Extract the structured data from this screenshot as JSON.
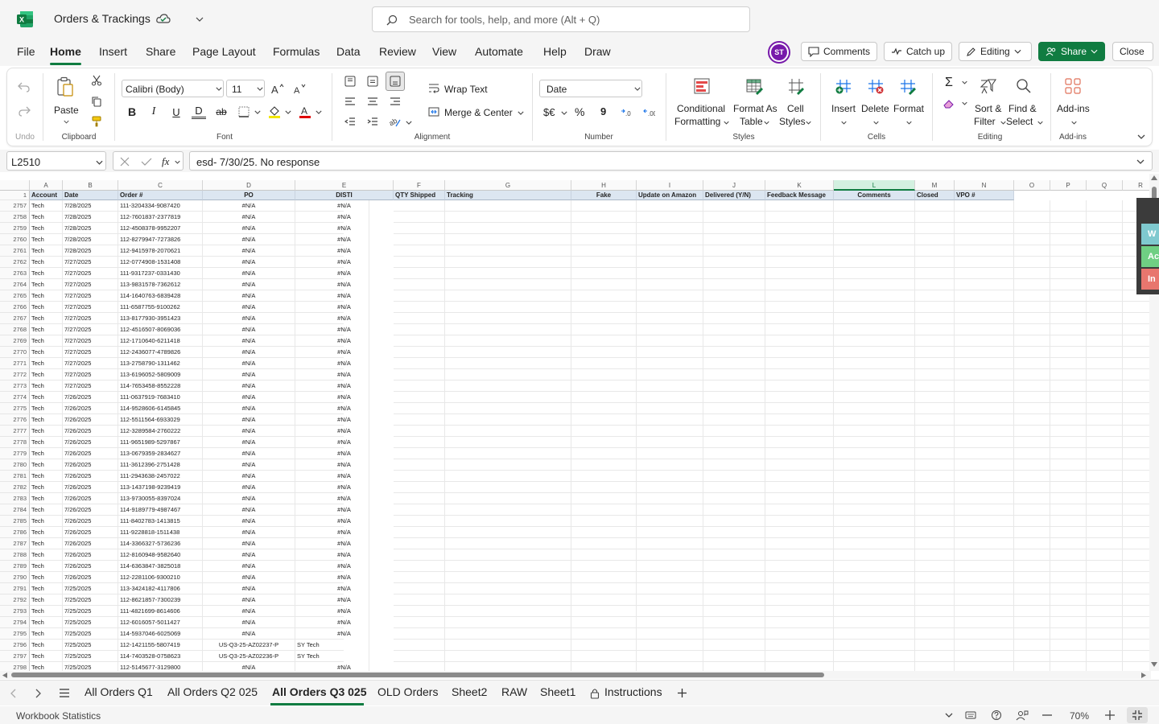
{
  "app": {
    "name": "Excel",
    "file_title": "Orders & Trackings"
  },
  "search": {
    "placeholder": "Search for tools, help, and more (Alt + Q)"
  },
  "menu": [
    "File",
    "Home",
    "Insert",
    "Share",
    "Page Layout",
    "Formulas",
    "Data",
    "Review",
    "View",
    "Automate",
    "Help",
    "Draw"
  ],
  "active_menu": "Home",
  "user": {
    "initials": "ST"
  },
  "top_buttons": {
    "comments": "Comments",
    "catchup": "Catch up",
    "editing": "Editing",
    "share": "Share",
    "close": "Close"
  },
  "ribbon": {
    "undo_group": "Undo",
    "clipboard": {
      "paste": "Paste",
      "group": "Clipboard"
    },
    "font": {
      "name": "Calibri (Body)",
      "size": "11",
      "group": "Font"
    },
    "alignment": {
      "wrap": "Wrap Text",
      "merge": "Merge & Center",
      "group": "Alignment"
    },
    "number": {
      "format": "Date",
      "currency": "$€",
      "percent": "%",
      "comma": "9",
      "group": "Number"
    },
    "styles": {
      "cond_1": "Conditional",
      "cond_2": "Formatting",
      "fmt_1": "Format As",
      "fmt_2": "Table",
      "cell_1": "Cell",
      "cell_2": "Styles",
      "group": "Styles"
    },
    "cells": {
      "insert": "Insert",
      "delete": "Delete",
      "format": "Format",
      "group": "Cells"
    },
    "editing": {
      "sort_1": "Sort &",
      "sort_2": "Filter",
      "find_1": "Find &",
      "find_2": "Select",
      "group": "Editing"
    },
    "addins": {
      "label": "Add-ins",
      "group": "Add-ins"
    }
  },
  "formula_bar": {
    "name_box": "L2510",
    "fx": "fx",
    "content": "esd- 7/30/25. No response"
  },
  "columns": [
    "A",
    "B",
    "C",
    "D",
    "E",
    "F",
    "G",
    "H",
    "I",
    "J",
    "K",
    "L",
    "M",
    "N",
    "O",
    "P",
    "Q",
    "R"
  ],
  "header_row": {
    "num": "1",
    "cells": [
      "Account",
      "Date",
      "Order #",
      "PO",
      "DISTI",
      "QTY Shipped",
      "Tracking",
      "Fake",
      "Update on Amazon",
      "Delivered (Y/N)",
      "Feedback Message",
      "Comments",
      "Closed",
      "VPO #"
    ]
  },
  "rows": [
    {
      "n": "2757",
      "a": "Tech",
      "b": "7/28/2025",
      "c": "111-3204334-9087420",
      "d": "#N/A",
      "e": "",
      "f": "#N/A"
    },
    {
      "n": "2758",
      "a": "Tech",
      "b": "7/28/2025",
      "c": "112-7601837-2377819",
      "d": "#N/A",
      "e": "",
      "f": "#N/A"
    },
    {
      "n": "2759",
      "a": "Tech",
      "b": "7/28/2025",
      "c": "112-4508378-9952207",
      "d": "#N/A",
      "e": "",
      "f": "#N/A"
    },
    {
      "n": "2760",
      "a": "Tech",
      "b": "7/28/2025",
      "c": "112-8279947-7273826",
      "d": "#N/A",
      "e": "",
      "f": "#N/A"
    },
    {
      "n": "2761",
      "a": "Tech",
      "b": "7/28/2025",
      "c": "112-9415978-2070621",
      "d": "#N/A",
      "e": "",
      "f": "#N/A"
    },
    {
      "n": "2762",
      "a": "Tech",
      "b": "7/27/2025",
      "c": "112-0774908-1531408",
      "d": "#N/A",
      "e": "",
      "f": "#N/A"
    },
    {
      "n": "2763",
      "a": "Tech",
      "b": "7/27/2025",
      "c": "111-9317237-0331430",
      "d": "#N/A",
      "e": "",
      "f": "#N/A"
    },
    {
      "n": "2764",
      "a": "Tech",
      "b": "7/27/2025",
      "c": "113-9831578-7362612",
      "d": "#N/A",
      "e": "",
      "f": "#N/A"
    },
    {
      "n": "2765",
      "a": "Tech",
      "b": "7/27/2025",
      "c": "114-1640763-6839428",
      "d": "#N/A",
      "e": "",
      "f": "#N/A"
    },
    {
      "n": "2766",
      "a": "Tech",
      "b": "7/27/2025",
      "c": "111-6587755-9100262",
      "d": "#N/A",
      "e": "",
      "f": "#N/A"
    },
    {
      "n": "2767",
      "a": "Tech",
      "b": "7/27/2025",
      "c": "113-8177930-3951423",
      "d": "#N/A",
      "e": "",
      "f": "#N/A"
    },
    {
      "n": "2768",
      "a": "Tech",
      "b": "7/27/2025",
      "c": "112-4516507-8069036",
      "d": "#N/A",
      "e": "",
      "f": "#N/A"
    },
    {
      "n": "2769",
      "a": "Tech",
      "b": "7/27/2025",
      "c": "112-1710640-6211418",
      "d": "#N/A",
      "e": "",
      "f": "#N/A"
    },
    {
      "n": "2770",
      "a": "Tech",
      "b": "7/27/2025",
      "c": "112-2436077-4789826",
      "d": "#N/A",
      "e": "",
      "f": "#N/A"
    },
    {
      "n": "2771",
      "a": "Tech",
      "b": "7/27/2025",
      "c": "113-2758790-1311462",
      "d": "#N/A",
      "e": "",
      "f": "#N/A"
    },
    {
      "n": "2772",
      "a": "Tech",
      "b": "7/27/2025",
      "c": "113-6196052-5809009",
      "d": "#N/A",
      "e": "",
      "f": "#N/A"
    },
    {
      "n": "2773",
      "a": "Tech",
      "b": "7/27/2025",
      "c": "114-7653458-8552228",
      "d": "#N/A",
      "e": "",
      "f": "#N/A"
    },
    {
      "n": "2774",
      "a": "Tech",
      "b": "7/26/2025",
      "c": "111-0637919-7683410",
      "d": "#N/A",
      "e": "",
      "f": "#N/A"
    },
    {
      "n": "2775",
      "a": "Tech",
      "b": "7/26/2025",
      "c": "114-9528606-6145845",
      "d": "#N/A",
      "e": "",
      "f": "#N/A"
    },
    {
      "n": "2776",
      "a": "Tech",
      "b": "7/26/2025",
      "c": "112-5511564-6933029",
      "d": "#N/A",
      "e": "",
      "f": "#N/A"
    },
    {
      "n": "2777",
      "a": "Tech",
      "b": "7/26/2025",
      "c": "112-3289584-2760222",
      "d": "#N/A",
      "e": "",
      "f": "#N/A"
    },
    {
      "n": "2778",
      "a": "Tech",
      "b": "7/26/2025",
      "c": "111-9651989-5297867",
      "d": "#N/A",
      "e": "",
      "f": "#N/A"
    },
    {
      "n": "2779",
      "a": "Tech",
      "b": "7/26/2025",
      "c": "113-0679359-2834627",
      "d": "#N/A",
      "e": "",
      "f": "#N/A"
    },
    {
      "n": "2780",
      "a": "Tech",
      "b": "7/26/2025",
      "c": "111-3612396-2751428",
      "d": "#N/A",
      "e": "",
      "f": "#N/A"
    },
    {
      "n": "2781",
      "a": "Tech",
      "b": "7/26/2025",
      "c": "111-2943638-2457022",
      "d": "#N/A",
      "e": "",
      "f": "#N/A"
    },
    {
      "n": "2782",
      "a": "Tech",
      "b": "7/26/2025",
      "c": "113-1437198-9239419",
      "d": "#N/A",
      "e": "",
      "f": "#N/A"
    },
    {
      "n": "2783",
      "a": "Tech",
      "b": "7/26/2025",
      "c": "113-9730055-8397024",
      "d": "#N/A",
      "e": "",
      "f": "#N/A"
    },
    {
      "n": "2784",
      "a": "Tech",
      "b": "7/26/2025",
      "c": "114-9189779-4987467",
      "d": "#N/A",
      "e": "",
      "f": "#N/A"
    },
    {
      "n": "2785",
      "a": "Tech",
      "b": "7/26/2025",
      "c": "111-8402783-1413815",
      "d": "#N/A",
      "e": "",
      "f": "#N/A"
    },
    {
      "n": "2786",
      "a": "Tech",
      "b": "7/26/2025",
      "c": "111-9228818-1511438",
      "d": "#N/A",
      "e": "",
      "f": "#N/A"
    },
    {
      "n": "2787",
      "a": "Tech",
      "b": "7/26/2025",
      "c": "114-3366327-5736236",
      "d": "#N/A",
      "e": "",
      "f": "#N/A"
    },
    {
      "n": "2788",
      "a": "Tech",
      "b": "7/26/2025",
      "c": "112-8160948-9582640",
      "d": "#N/A",
      "e": "",
      "f": "#N/A"
    },
    {
      "n": "2789",
      "a": "Tech",
      "b": "7/26/2025",
      "c": "114-6363847-3825018",
      "d": "#N/A",
      "e": "",
      "f": "#N/A"
    },
    {
      "n": "2790",
      "a": "Tech",
      "b": "7/26/2025",
      "c": "112-2281106-9300210",
      "d": "#N/A",
      "e": "",
      "f": "#N/A"
    },
    {
      "n": "2791",
      "a": "Tech",
      "b": "7/25/2025",
      "c": "113-3424182-4117806",
      "d": "#N/A",
      "e": "",
      "f": "#N/A"
    },
    {
      "n": "2792",
      "a": "Tech",
      "b": "7/25/2025",
      "c": "112-8621857-7300239",
      "d": "#N/A",
      "e": "",
      "f": "#N/A"
    },
    {
      "n": "2793",
      "a": "Tech",
      "b": "7/25/2025",
      "c": "111-4821699-8614606",
      "d": "#N/A",
      "e": "",
      "f": "#N/A"
    },
    {
      "n": "2794",
      "a": "Tech",
      "b": "7/25/2025",
      "c": "112-6016057-5011427",
      "d": "#N/A",
      "e": "",
      "f": "#N/A"
    },
    {
      "n": "2795",
      "a": "Tech",
      "b": "7/25/2025",
      "c": "114-5937046-6025069",
      "d": "#N/A",
      "e": "",
      "f": "#N/A"
    },
    {
      "n": "2796",
      "a": "Tech",
      "b": "7/25/2025",
      "c": "112-1421155-5807419",
      "d": "US-Q3-25-AZ02237-P",
      "e": "SY Tech",
      "f": ""
    },
    {
      "n": "2797",
      "a": "Tech",
      "b": "7/25/2025",
      "c": "114-7403528-0758623",
      "d": "US-Q3-25-AZ02236-P",
      "e": "SY Tech",
      "f": ""
    },
    {
      "n": "2798",
      "a": "Tech",
      "b": "7/25/2025",
      "c": "112-5145677-3129800",
      "d": "#N/A",
      "e": "",
      "f": "#N/A"
    }
  ],
  "side_panel": [
    "W",
    "Ac",
    "In"
  ],
  "sheets": [
    "All Orders Q1",
    "All Orders Q2 025",
    "All Orders Q3 025",
    "OLD Orders",
    "Sheet2",
    "RAW",
    "Sheet1",
    "Instructions"
  ],
  "active_sheet": "All Orders Q3 025",
  "status": {
    "left": "Workbook Statistics",
    "zoom": "70%"
  },
  "colors": {
    "accent": "#107c41",
    "header_fill": "#dce6f1",
    "selected_col": "#d3f0e0"
  }
}
